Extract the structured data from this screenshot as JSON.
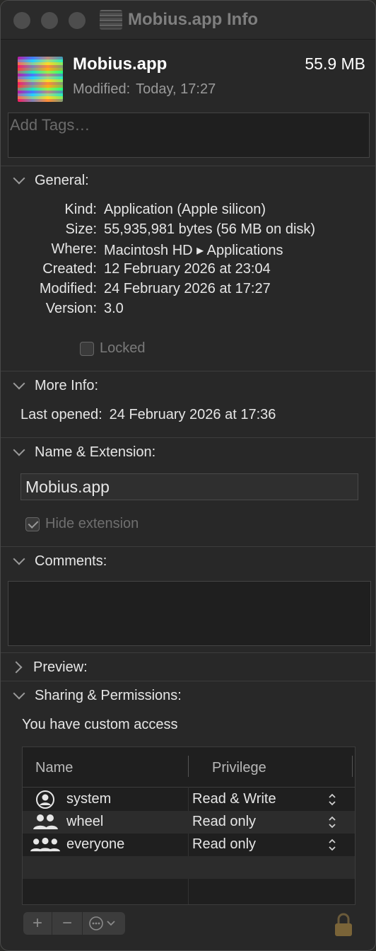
{
  "window": {
    "title": "Mobius.app Info"
  },
  "header": {
    "name": "Mobius.app",
    "size": "55.9 MB",
    "modified_label": "Modified:",
    "modified_value": "Today, 17:27"
  },
  "tags": {
    "placeholder": "Add Tags…"
  },
  "general": {
    "title": "General:",
    "rows": [
      {
        "label": "Kind:",
        "value": "Application (Apple silicon)"
      },
      {
        "label": "Size:",
        "value": "55,935,981 bytes (56 MB on disk)"
      },
      {
        "label": "Where:",
        "value": "Macintosh HD ▸ Applications"
      },
      {
        "label": "Created:",
        "value": "12 February 2026 at 23:04"
      },
      {
        "label": "Modified:",
        "value": "24 February 2026 at 17:27"
      },
      {
        "label": "Version:",
        "value": "3.0"
      }
    ],
    "locked_label": "Locked"
  },
  "more_info": {
    "title": "More Info:",
    "last_opened_label": "Last opened:",
    "last_opened_value": "24 February 2026 at 17:36"
  },
  "name_ext": {
    "title": "Name & Extension:",
    "value": "Mobius.app",
    "hide_extension_label": "Hide extension"
  },
  "comments": {
    "title": "Comments:",
    "value": ""
  },
  "preview": {
    "title": "Preview:"
  },
  "sharing": {
    "title": "Sharing & Permissions:",
    "access_text": "You have custom access",
    "columns": [
      "Name",
      "Privilege"
    ],
    "rows": [
      {
        "name": "system",
        "privilege": "Read & Write",
        "icon": "single-user-icon"
      },
      {
        "name": "wheel",
        "privilege": "Read only",
        "icon": "group-icon"
      },
      {
        "name": "everyone",
        "privilege": "Read only",
        "icon": "everyone-icon"
      }
    ]
  },
  "toolbar": {
    "add": "+",
    "remove": "−"
  }
}
